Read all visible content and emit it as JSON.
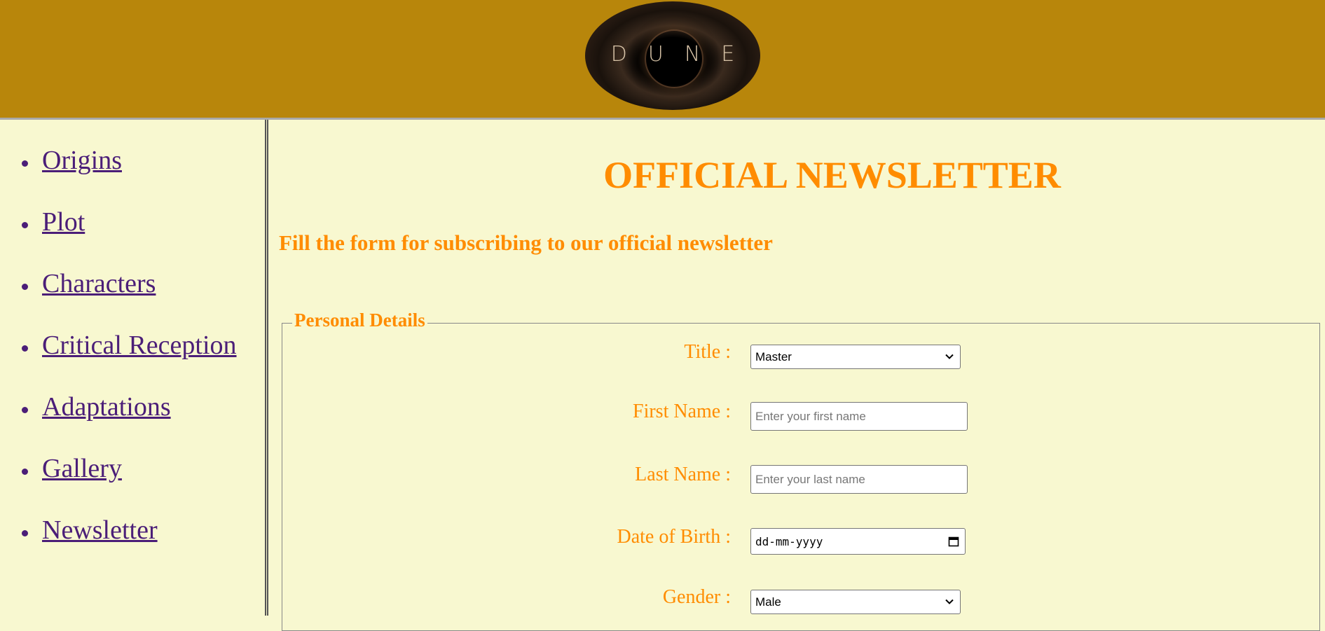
{
  "header": {
    "logo_text": "DUNE",
    "logo_colors": {
      "bg": "#000000",
      "text": "#D8C4A8"
    }
  },
  "sidebar": {
    "items": [
      {
        "label": "Origins"
      },
      {
        "label": "Plot"
      },
      {
        "label": "Characters"
      },
      {
        "label": "Critical Reception"
      },
      {
        "label": "Adaptations"
      },
      {
        "label": "Gallery"
      },
      {
        "label": "Newsletter"
      }
    ]
  },
  "main": {
    "title": "OFFICIAL NEWSLETTER",
    "subtitle": "Fill the form for subscribing to our official newsletter",
    "fieldset": {
      "legend": "Personal Details",
      "title_label": "Title :",
      "title_value": "Master",
      "first_name_label": "First Name :",
      "first_name_placeholder": "Enter your first name",
      "last_name_label": "Last Name :",
      "last_name_placeholder": "Enter your last name",
      "dob_label": "Date of Birth :",
      "dob_placeholder": "dd-mm-yyyy",
      "gender_label": "Gender :",
      "gender_value": "Male"
    }
  },
  "colors": {
    "header_bg": "#B8860B",
    "page_bg": "#F8F8D0",
    "accent": "#FF8C00",
    "link": "#4B1E78"
  }
}
